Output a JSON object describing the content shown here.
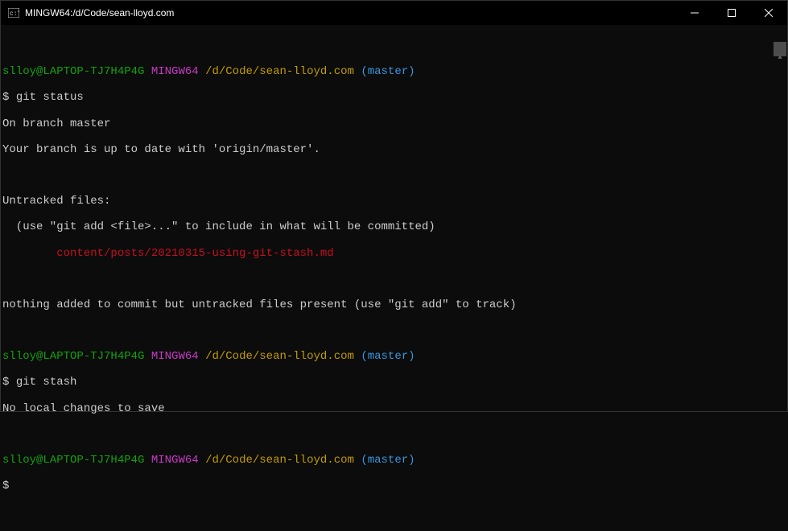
{
  "titlebar": {
    "title": "MINGW64:/d/Code/sean-lloyd.com"
  },
  "prompt": {
    "user_host": "slloy@LAPTOP-TJ7H4P4G",
    "shell": "MINGW64",
    "path": "/d/Code/sean-lloyd.com",
    "branch_open": "(",
    "branch": "master",
    "branch_close": ")",
    "ps1": "$"
  },
  "block1": {
    "command": "git status",
    "out1": "On branch master",
    "out2": "Your branch is up to date with 'origin/master'.",
    "out3": "",
    "out4": "Untracked files:",
    "out5": "  (use \"git add <file>...\" to include in what will be committed)",
    "out6": "        content/posts/20210315-using-git-stash.md",
    "out7": "",
    "out8": "nothing added to commit but untracked files present (use \"git add\" to track)"
  },
  "block2": {
    "command": "git stash",
    "out1": "No local changes to save"
  },
  "block3": {
    "command": ""
  }
}
